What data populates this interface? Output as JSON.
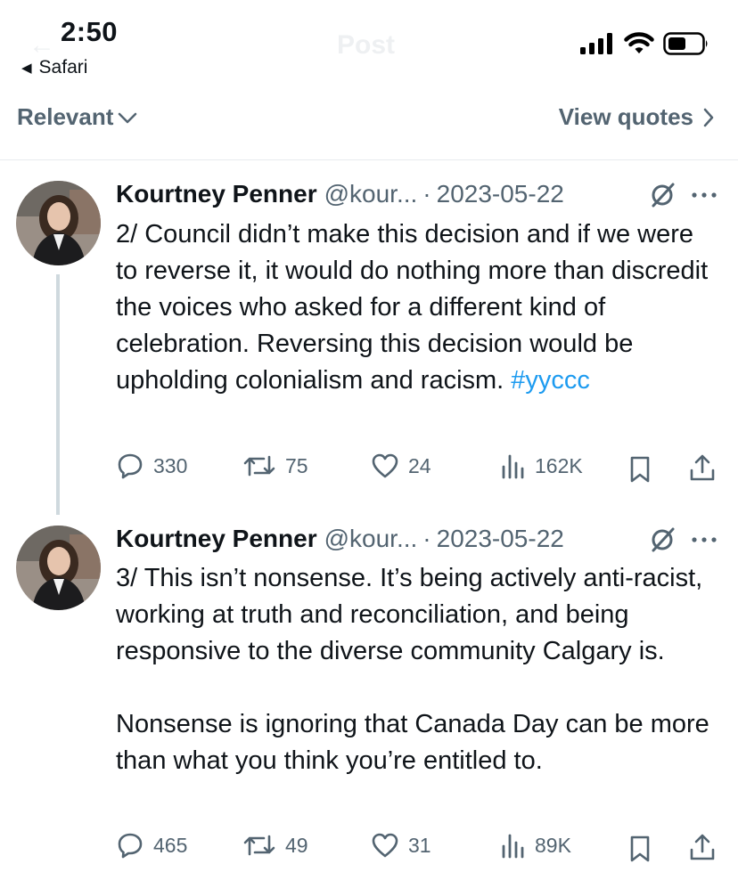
{
  "status_bar": {
    "time": "2:50",
    "back_app": "Safari",
    "ghost_title": "Post",
    "back_icon": "back-arrow-icon",
    "signal_icon": "cellular-signal-icon",
    "wifi_icon": "wifi-icon",
    "battery_icon": "battery-icon"
  },
  "sort_bar": {
    "relevant_label": "Relevant",
    "view_quotes_label": "View quotes"
  },
  "tweets": [
    {
      "author": "Kourtney Penner",
      "handle": "@kour...",
      "separator": "·",
      "date": "2023-05-22",
      "text_main": "2/ Council didn’t make this decision and if we were to reverse it, it would do nothing more than discredit the voices who asked for a different kind of celebration. Reversing this decision would be upholding colonialism and racism. ",
      "hashtag": "#yyccc",
      "replies": "330",
      "reposts": "75",
      "likes": "24",
      "views": "162K"
    },
    {
      "author": "Kourtney Penner",
      "handle": "@kour...",
      "separator": "·",
      "date": "2023-05-22",
      "text_main": "3/ This isn’t nonsense. It’s being actively anti-racist, working at truth and reconciliation, and being responsive to the diverse community Calgary is.\n\nNonsense is ignoring that Canada Day can be more than what you think you’re entitled to.",
      "replies": "465",
      "reposts": "49",
      "likes": "31",
      "views": "89K"
    }
  ],
  "colors": {
    "text": "#0f1419",
    "secondary": "#536471",
    "link": "#1d9bf0",
    "thread_line": "#cfd9de",
    "divider": "#e8ecef"
  }
}
